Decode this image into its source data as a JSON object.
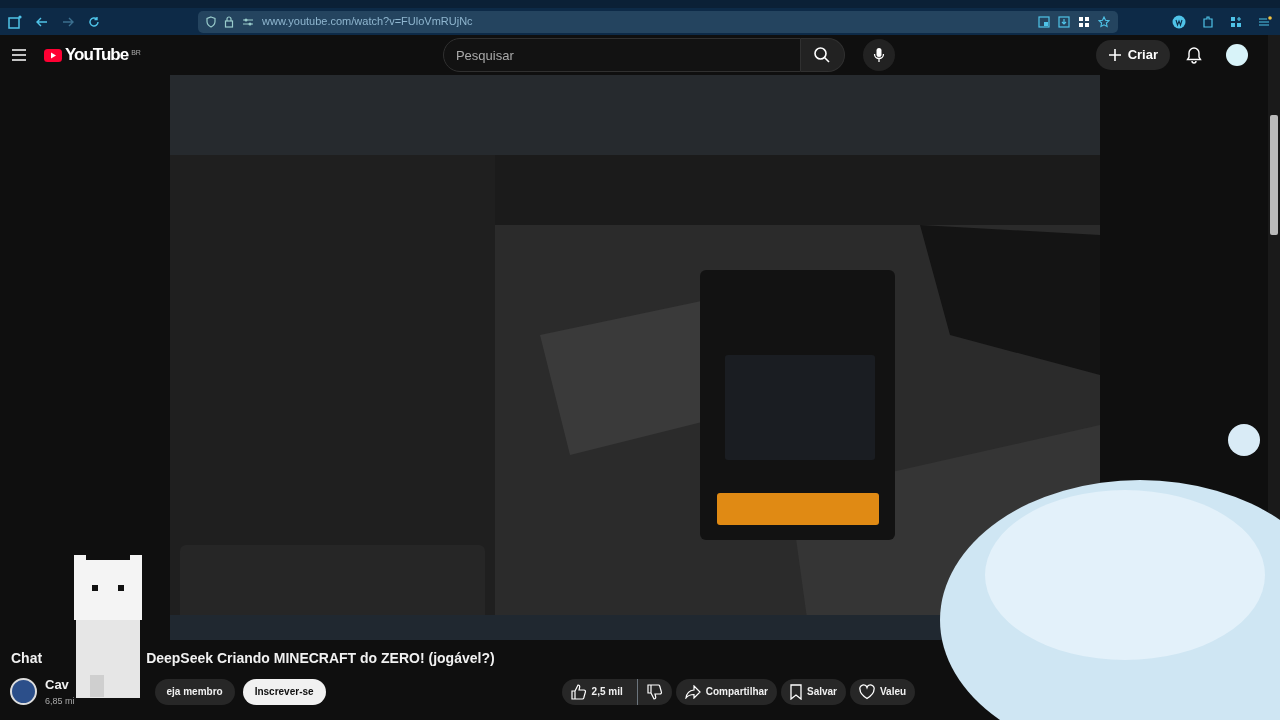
{
  "browser": {
    "url": "www.youtube.com/watch?v=FUloVmRUjNc"
  },
  "header": {
    "logo": "YouTube",
    "region": "BR",
    "search": {
      "placeholder": "Pesquisar"
    },
    "create_button": "Criar"
  },
  "title_parts": [
    "Chat",
    "DeepSeek Criando MINECRAFT do ZERO! (jogável?)"
  ],
  "channel": {
    "name": "Cav",
    "subscribers": "6,85 mi",
    "join_button": "eja membro",
    "subscribe_button": "Inscrever-se"
  },
  "actions": {
    "likes": "2,5 mil",
    "share": "Compartilhar",
    "save": "Salvar",
    "thanks": "Valeu"
  }
}
